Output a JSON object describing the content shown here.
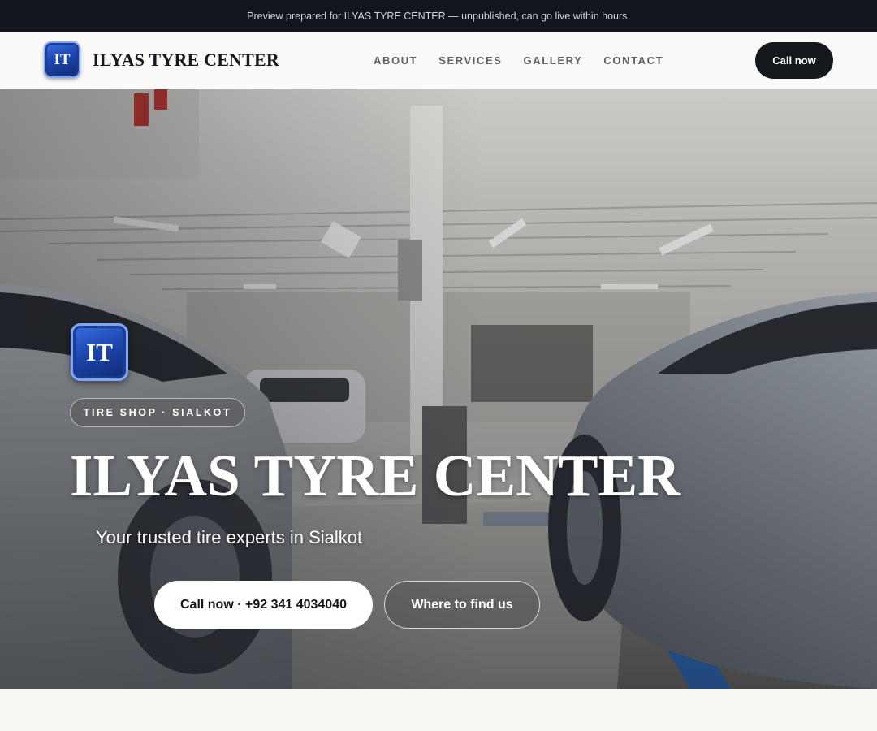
{
  "preview_bar": {
    "text": "Preview prepared for ILYAS TYRE CENTER — unpublished, can go live within hours."
  },
  "header": {
    "logo_initials": "IT",
    "brand_name": "ILYAS TYRE CENTER",
    "nav": [
      {
        "label": "ABOUT"
      },
      {
        "label": "SERVICES"
      },
      {
        "label": "GALLERY"
      },
      {
        "label": "CONTACT"
      }
    ],
    "cta_label": "Call now"
  },
  "hero": {
    "logo_initials": "IT",
    "pill_text": "TIRE SHOP · SIALKOT",
    "title": "ILYAS TYRE CENTER",
    "tagline": "Your trusted tire experts in Sialkot",
    "primary_button": "Call now · +92 341 4034040",
    "secondary_button": "Where to find us",
    "image_subject": "garage-workshop-photo"
  },
  "colors": {
    "dark": "#14171c",
    "page_bg": "#f9f8f5",
    "logo_blue": "#1d47b0",
    "nav_text": "#5b6068"
  }
}
